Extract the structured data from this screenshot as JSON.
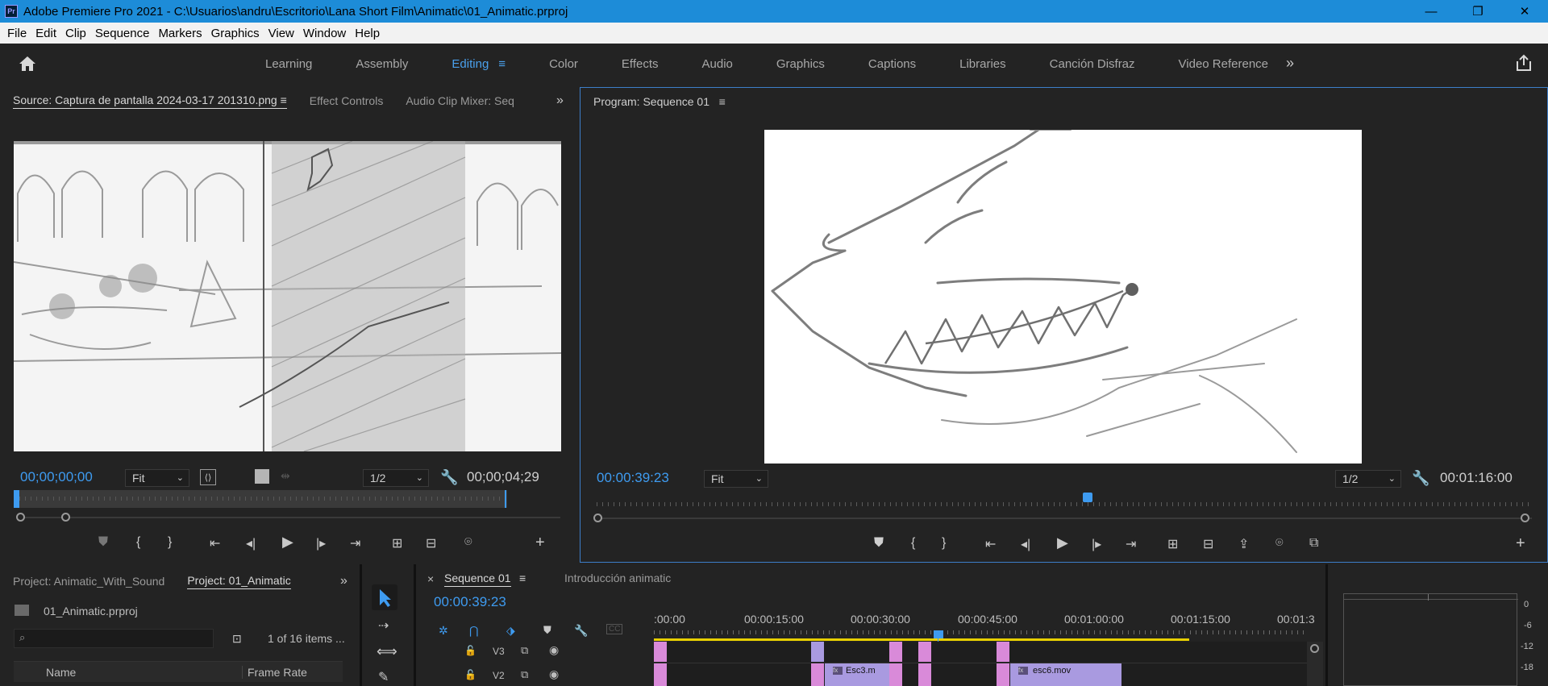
{
  "window": {
    "title": "Adobe Premiere Pro 2021 - C:\\Usuarios\\andru\\Escritorio\\Lana Short Film\\Animatic\\01_Animatic.prproj",
    "app_icon": "Pr",
    "minimize": "—",
    "restore": "❐",
    "close": "✕"
  },
  "menu": [
    "File",
    "Edit",
    "Clip",
    "Sequence",
    "Markers",
    "Graphics",
    "View",
    "Window",
    "Help"
  ],
  "workspaces": {
    "tabs": [
      "Learning",
      "Assembly",
      "Editing",
      "Color",
      "Effects",
      "Audio",
      "Graphics",
      "Captions",
      "Libraries",
      "Canción Disfraz",
      "Video Reference"
    ],
    "active": "Editing",
    "more": "»",
    "hamburger": "≡"
  },
  "source": {
    "tabs": [
      "Source: Captura de pantalla 2024-03-17 201310.png",
      "Effect Controls",
      "Audio Clip Mixer: Seq"
    ],
    "active_tab": "Source: Captura de pantalla 2024-03-17 201310.png",
    "more": "»",
    "timecode": "00;00;00;00",
    "zoom": "Fit",
    "resolution": "1/2",
    "duration": "00;00;04;29",
    "playhead_fraction": 0.0
  },
  "program": {
    "title": "Program: Sequence 01",
    "timecode": "00:00:39:23",
    "zoom": "Fit",
    "resolution": "1/2",
    "duration": "00:01:16:00",
    "playhead_fraction": 0.525
  },
  "project": {
    "tabs": [
      "Project: Animatic_With_Sound",
      "Project: 01_Animatic"
    ],
    "active_tab": "Project: 01_Animatic",
    "more": "»",
    "file": "01_Animatic.prproj",
    "items_count": "1 of 16 items ...",
    "columns": [
      "Name",
      "Frame Rate"
    ],
    "search_placeholder": ""
  },
  "timeline": {
    "tabs": [
      "Sequence 01",
      "Introducción animatic"
    ],
    "active_tab": "Sequence 01",
    "close": "×",
    "hamburger": "≡",
    "timecode": "00:00:39:23",
    "ruler_labels": [
      ":00:00",
      "00:00:15:00",
      "00:00:30:00",
      "00:00:45:00",
      "00:01:00:00",
      "00:01:15:00",
      "00:01:3"
    ],
    "tracks": [
      {
        "name": "V3"
      },
      {
        "name": "V2"
      }
    ],
    "clips": [
      {
        "label": "Esc3.m"
      },
      {
        "label": "esc6.mov"
      }
    ]
  },
  "audio_meter": {
    "labels": [
      "0",
      "-6",
      "-12",
      "-18"
    ]
  },
  "colors": {
    "accent": "#3e9bf0",
    "titlebar": "#1d8cd8",
    "clip_pink": "#d98ad9",
    "clip_violet": "#a99ae0",
    "work_area": "#e8d000"
  }
}
